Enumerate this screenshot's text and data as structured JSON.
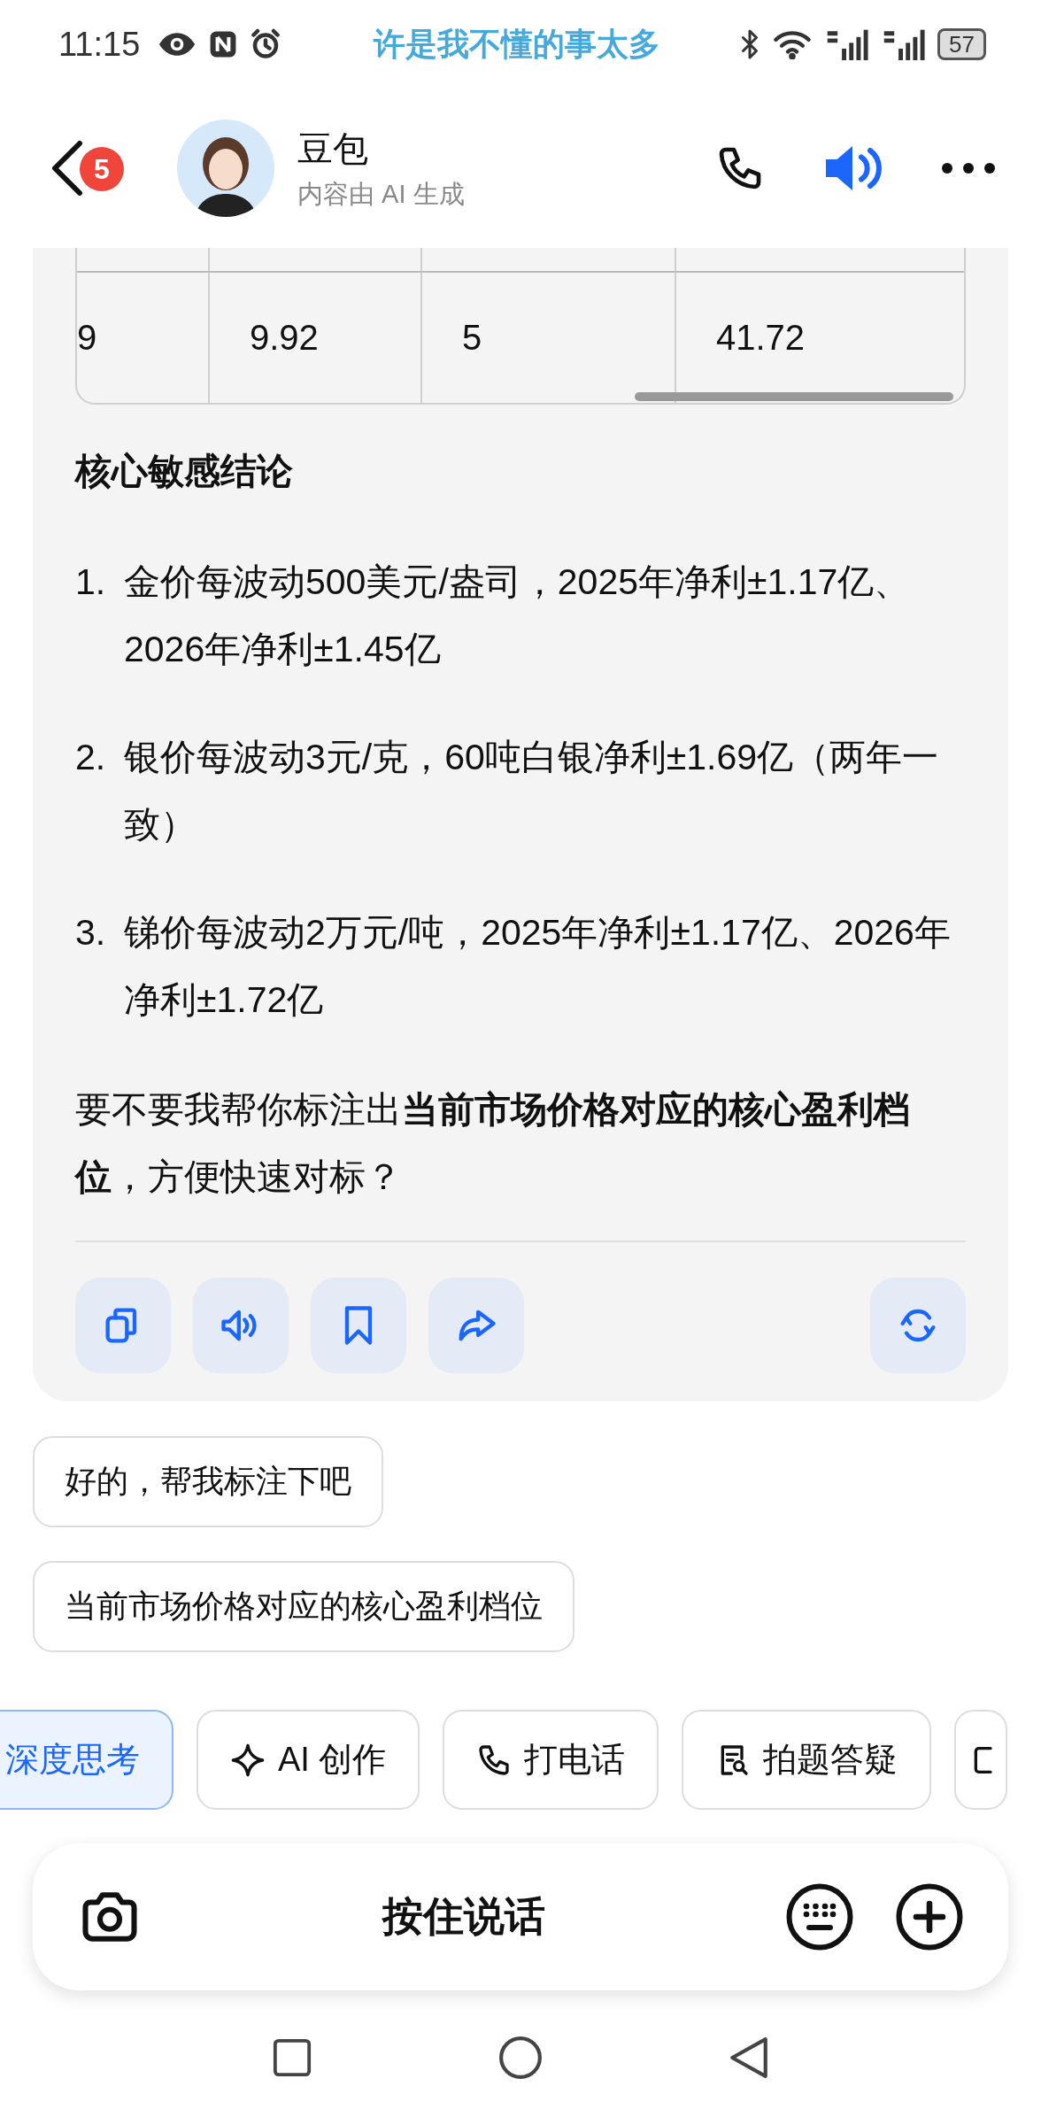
{
  "status_bar": {
    "time": "11:15",
    "ticker": "许是我不懂的事太多",
    "battery": "57"
  },
  "header": {
    "back_badge": "5",
    "name": "豆包",
    "subtitle": "内容由 AI 生成",
    "speaker_on": true
  },
  "table": {
    "rows": [
      [
        "9",
        "9.92",
        "5",
        "41.72"
      ]
    ]
  },
  "heading": "核心敏感结论",
  "list": [
    {
      "number": "1.",
      "text": "金价每波动500美元/盎司，2025年净利±1.17亿、2026年净利±1.45亿"
    },
    {
      "number": "2.",
      "text": "银价每波动3元/克，60吨白银净利±1.69亿（两年一致）"
    },
    {
      "number": "3.",
      "text": "锑价每波动2万元/吨，2025年净利±1.17亿、2026年净利±1.72亿"
    }
  ],
  "closing": "要不要我帮你标注出**当前市场价格对应的核心盈利档位**，方便快速对标？",
  "actions": [
    {
      "kind": "copy"
    },
    {
      "kind": "speak"
    },
    {
      "kind": "bookmark"
    },
    {
      "kind": "share"
    },
    {
      "kind": "regenerate"
    }
  ],
  "suggestions": [
    "好的，帮我标注下吧",
    "当前市场价格对应的核心盈利档位"
  ],
  "tools": [
    {
      "kind": "plain",
      "label": "深度思考",
      "selected": true
    },
    {
      "kind": "sparkle",
      "label": "AI 创作",
      "selected": false
    },
    {
      "kind": "phone",
      "label": "打电话",
      "selected": false
    },
    {
      "kind": "scan",
      "label": "拍题答疑",
      "selected": false
    },
    {
      "kind": "partial",
      "selected": false
    }
  ],
  "input": {
    "label": "按住说话"
  }
}
